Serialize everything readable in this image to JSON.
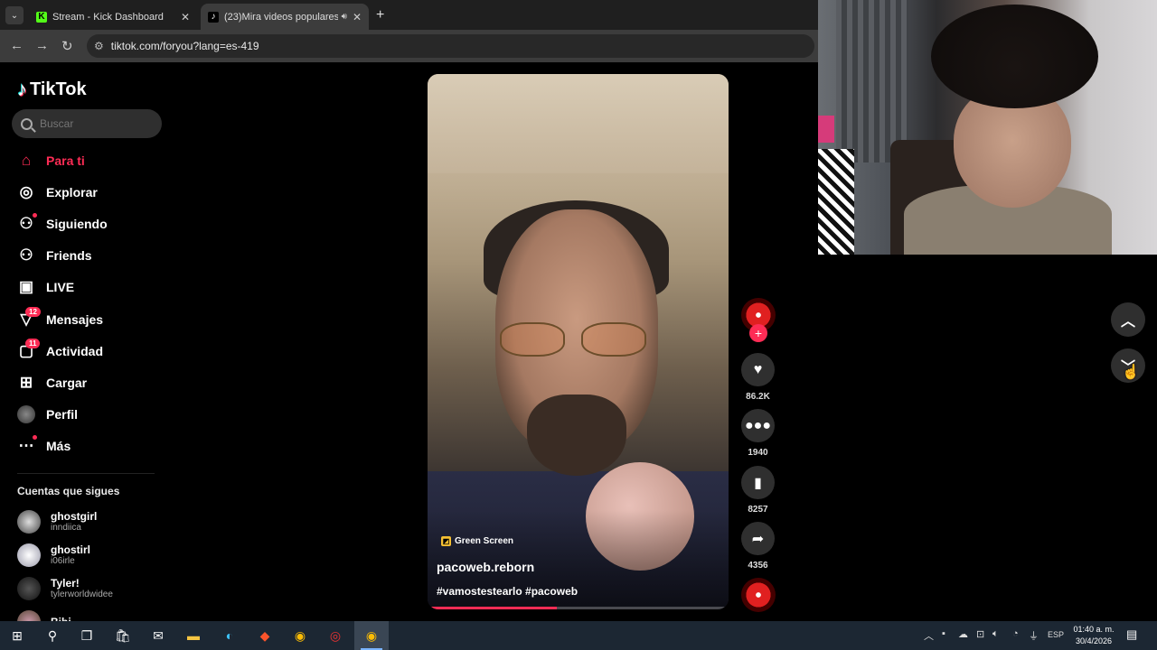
{
  "browser": {
    "tabs": [
      {
        "title": "Stream - Kick Dashboard",
        "favicon": "K"
      },
      {
        "title": "(23)Mira videos populares",
        "favicon": "♪"
      }
    ],
    "url": "tiktok.com/foryou?lang=es-419"
  },
  "tiktok": {
    "logo": "TikTok",
    "search_placeholder": "Buscar",
    "nav": [
      {
        "label": "Para ti",
        "icon": "home-icon"
      },
      {
        "label": "Explorar",
        "icon": "compass-icon"
      },
      {
        "label": "Siguiendo",
        "icon": "following-icon"
      },
      {
        "label": "Friends",
        "icon": "friends-icon"
      },
      {
        "label": "LIVE",
        "icon": "live-icon"
      },
      {
        "label": "Mensajes",
        "icon": "messages-icon",
        "badge": "12"
      },
      {
        "label": "Actividad",
        "icon": "activity-icon",
        "badge": "11"
      },
      {
        "label": "Cargar",
        "icon": "upload-icon"
      },
      {
        "label": "Perfil",
        "icon": "profile-avatar"
      },
      {
        "label": "Más",
        "icon": "more-icon"
      }
    ],
    "following_header": "Cuentas que sigues",
    "following": [
      {
        "name": "ghostgirl",
        "handle": "inndiica"
      },
      {
        "name": "ghostirl",
        "handle": "i06irle"
      },
      {
        "name": "Tyler!",
        "handle": "tylerworldwidee"
      },
      {
        "name": "Bibi",
        "handle": ""
      }
    ]
  },
  "video": {
    "effect": "Green Screen",
    "username": "pacoweb.reborn",
    "hashtags": "#vamostestearlo #pacoweb",
    "progress": 0.43,
    "likes": "86.2K",
    "comments": "1940",
    "saves": "8257",
    "shares": "4356"
  },
  "taskbar": {
    "lang": "ESP",
    "time": "01:40 a. m.",
    "date": "30/4/2026"
  },
  "colors": {
    "accent": "#fe2c55",
    "background": "#000000"
  }
}
